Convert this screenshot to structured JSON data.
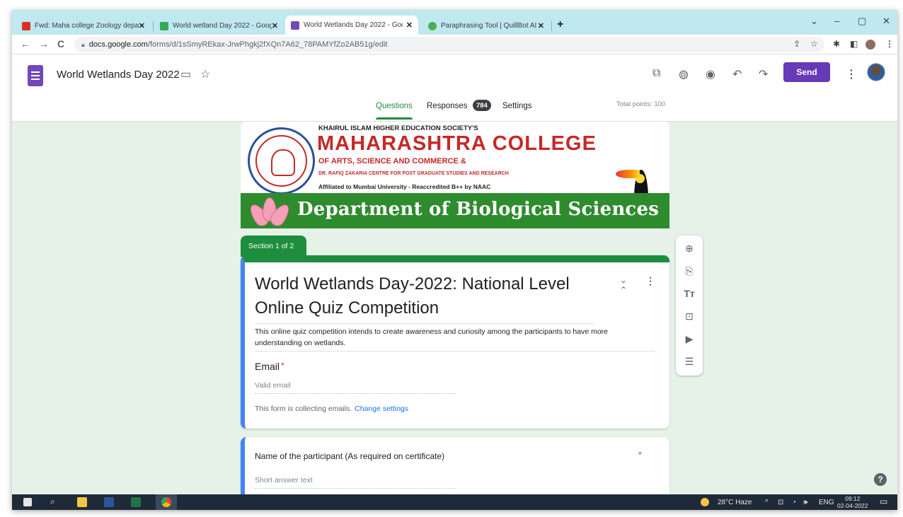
{
  "browser": {
    "tabs": [
      {
        "title": "Fwd: Maha college Zoology depa",
        "close": "✕",
        "favicon_color": "#d93025",
        "active": false
      },
      {
        "title": "World wetland Day 2022 - Goog",
        "close": "✕",
        "favicon_color": "#34a853",
        "active": false
      },
      {
        "title": "World Wetlands Day 2022 - Goo",
        "close": "✕",
        "favicon_color": "#7248b9",
        "active": true
      },
      {
        "title": "Paraphrasing Tool | QuillBot AI",
        "close": "✕",
        "favicon_color": "#4caf50",
        "active": false
      }
    ],
    "new_tab": "+",
    "window_controls": [
      "⌄",
      "–",
      "▢",
      "✕"
    ],
    "url_host": "docs.google.com",
    "url_path": "/forms/d/1sSmyREkax-JrwPhgkj2fXQn7A62_78PAMYfZo2AB51g/edit"
  },
  "forms_header": {
    "doc_title": "World Wetlands Day 2022",
    "send_label": "Send",
    "nav": {
      "questions": "Questions",
      "responses": "Responses",
      "responses_count": "784",
      "settings": "Settings"
    },
    "total_points": "Total points: 100",
    "accent_color": "#673ab7"
  },
  "banner": {
    "society": "KHAIRUL ISLAM HIGHER EDUCATION SOCIETY'S",
    "college": "MAHARASHTRA COLLEGE",
    "faculties": "OF ARTS, SCIENCE AND COMMERCE &",
    "centre": "DR. RAFIQ ZAKARIA CENTRE FOR POST GRADUATE STUDIES AND RESEARCH",
    "affiliation": "Affiliated to Mumbai University - Reaccredited B++ by NAAC",
    "department": "Department of Biological Sciences"
  },
  "form": {
    "section_label": "Section 1 of 2",
    "title": "World Wetlands Day-2022: National Level Online Quiz Competition",
    "description": "This online quiz competition intends to create awareness and curiosity among the participants to have more understanding on wetlands.",
    "email_label": "Email",
    "email_placeholder": "Valid email",
    "collecting_note": "This form is collecting emails.",
    "change_settings": "Change settings",
    "q2_label": "Name of the participant (As required on certificate)",
    "q2_placeholder": "Short answer text",
    "required_mark": "*",
    "theme_color": "#1e8e3e"
  },
  "taskbar": {
    "weather": "28°C  Haze",
    "language": "ENG",
    "time": "09:12",
    "date": "02-04-2022"
  }
}
